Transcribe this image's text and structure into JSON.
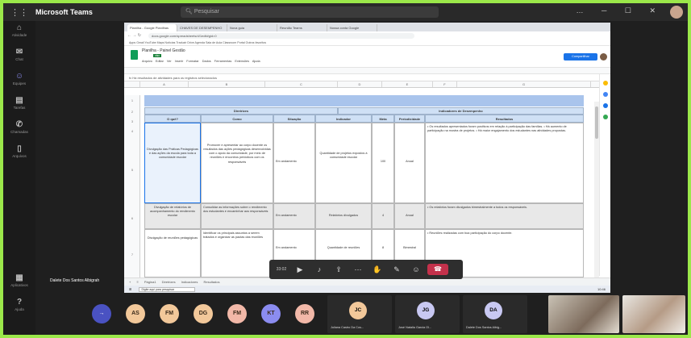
{
  "teams": {
    "app_name": "Microsoft Teams",
    "search_placeholder": "Pesquisar",
    "rail": [
      {
        "label": "Atividade",
        "icon": "bell-icon"
      },
      {
        "label": "Chat",
        "icon": "chat-icon"
      },
      {
        "label": "Equipes",
        "icon": "teams-icon"
      },
      {
        "label": "Tarefas",
        "icon": "tasks-icon"
      },
      {
        "label": "Chamadas",
        "icon": "phone-icon"
      },
      {
        "label": "Arquivos",
        "icon": "files-icon"
      }
    ],
    "rail_bottom": [
      {
        "label": "Aplicativos",
        "icon": "apps-icon"
      },
      {
        "label": "Ajuda",
        "icon": "help-icon"
      }
    ],
    "presenter_label": "Dalete Dos Santos Albigrah",
    "call_time": "33:02"
  },
  "browser": {
    "tabs": [
      "Planilha - Google Planilhas",
      "CHAVES DE DESEMPENHO",
      "Nova guia",
      "Reunião Teams",
      "Nossa conta Google"
    ],
    "address": "docs.google.com/spreadsheets/d/1edit#gid=0",
    "bookmarks": "Apps  Gmail  YouTube  Maps  Notícias  Traduzir  Drive  Agenda  Sala de Aula  Classroom  Portal  Outros favoritos"
  },
  "sheet": {
    "doc_title": "Planilha - Painel Gestão",
    "doc_badge": "xlsx",
    "menu": "Arquivo  Editar  Ver  Inserir  Formatar  Dados  Ferramentas  Extensões  Ajuda",
    "share_label": "Compartilhar",
    "formula_text": "fx  Há resultados de atividades para os registros selecionados",
    "columns": [
      "A",
      "B",
      "C",
      "D",
      "E",
      "F",
      "G",
      "H"
    ],
    "section_left": "Diretrizes",
    "section_right": "Indicadores de Desempenho",
    "headers": [
      "O quê?",
      "Como",
      "Situação",
      "Indicador",
      "Meta",
      "Periodicidade",
      "Resultados"
    ],
    "rows": [
      {
        "num": "5",
        "o_que": "Divulgação das Práticas Pedagógicas e das ações da escola para toda a comunidade escolar",
        "como": "Promover e apresentar ao corpo docente os resultados das ações pedagógicas desenvolvidas com o apoio da comunidade, por meio de reuniões e encontros periódicos com os responsáveis",
        "situacao": "Em andamento",
        "indicador": "Quantidade de projetos expostos à comunidade escolar",
        "meta": "100",
        "periodicidade": "Anual",
        "resultados": "• Os resultados apresentados foram positivos em relação à participação das famílias. • Há aumento de participação na mostra de projetos. • Há maior engajamento dos estudantes nas atividades propostas."
      },
      {
        "num": "6",
        "o_que": "Divulgação de relatórios de acompanhamento do rendimento escolar",
        "como": "Consolidar as informações sobre o rendimento dos estudantes e encaminhar aos responsáveis",
        "situacao": "Em andamento",
        "indicador": "Relatórios divulgados",
        "meta": "4",
        "periodicidade": "Anual",
        "resultados": "• Os relatórios foram divulgados bimestralmente a todos os responsáveis."
      },
      {
        "num": "7",
        "o_que": "Divulgação de reuniões pedagógicas",
        "como": "Identificar os principais assuntos a serem tratados e organizar as pautas das reuniões",
        "situacao": "Em andamento",
        "indicador": "Quantidade de reuniões",
        "meta": "8",
        "periodicidade": "Bimestral",
        "resultados": "• Reuniões realizadas com boa participação do corpo docente."
      }
    ],
    "sheet_tabs": "+  ≡  Página1  Diretrizes  Indicadores  Resultados"
  },
  "taskbar": {
    "search_placeholder": "Digite aqui para pesquisar",
    "clock": "10:46"
  },
  "participants": {
    "avatars": [
      {
        "initials": "AS",
        "color": "#f2c89a"
      },
      {
        "initials": "FM",
        "color": "#f2c89a"
      },
      {
        "initials": "DG",
        "color": "#f2c89a"
      },
      {
        "initials": "FM",
        "color": "#f2b8a8"
      },
      {
        "initials": "KT",
        "color": "#8b8cf0"
      },
      {
        "initials": "RR",
        "color": "#f2b8a8"
      }
    ],
    "tiles": [
      {
        "initials": "JC",
        "name": "Juliana Castro Da Cos...",
        "color": "#f2c89a"
      },
      {
        "initials": "JG",
        "name": "José Natalia Garcia Ol...",
        "color": "#c8c8f2"
      },
      {
        "initials": "DA",
        "name": "Dalete Dos Santos Albig...",
        "color": "#c8c8f2"
      }
    ]
  }
}
